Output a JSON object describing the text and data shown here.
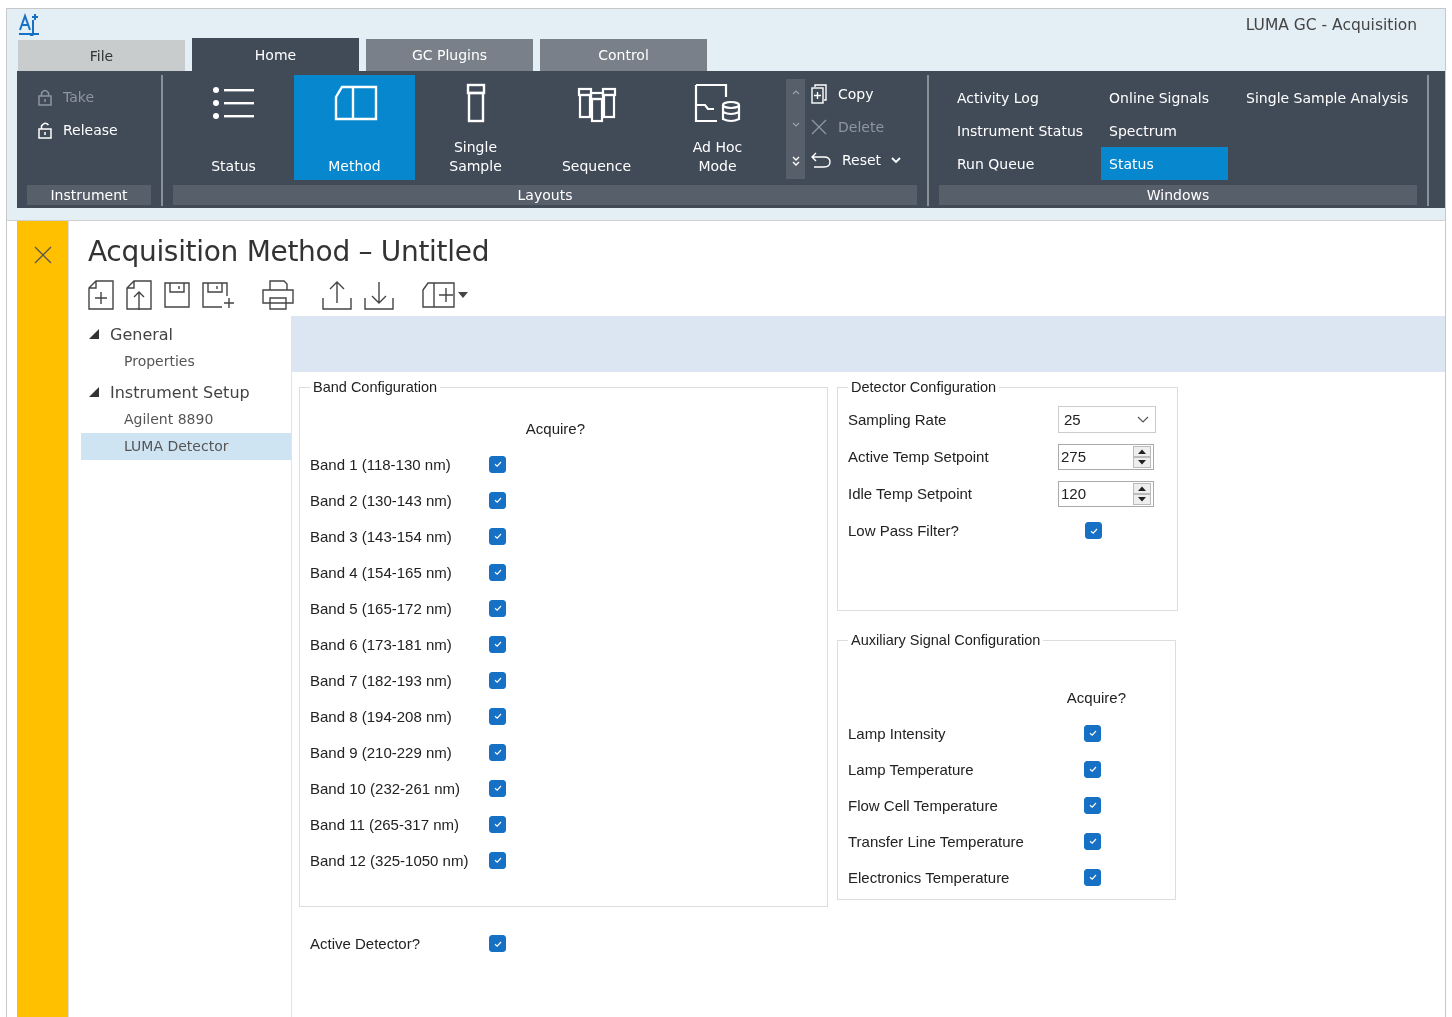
{
  "window": {
    "title": "LUMA GC - Acquisition"
  },
  "tabs": [
    {
      "label": "File",
      "selected": false,
      "kind": "file"
    },
    {
      "label": "Home",
      "selected": true,
      "kind": "tab"
    },
    {
      "label": "GC Plugins",
      "selected": false,
      "kind": "tab"
    },
    {
      "label": "Control",
      "selected": false,
      "kind": "tab"
    }
  ],
  "ribbon": {
    "instrument": {
      "label": "Instrument",
      "items": [
        {
          "label": "Take",
          "disabled": true,
          "kind": "lock"
        },
        {
          "label": "Release",
          "disabled": false,
          "kind": "unlock"
        }
      ]
    },
    "layouts": {
      "label": "Layouts",
      "buttons": [
        {
          "label": "Status",
          "kind": "list",
          "selected": false
        },
        {
          "label": "Method",
          "kind": "method",
          "selected": true
        },
        {
          "label": "Single Sample",
          "kind": "vial",
          "selected": false
        },
        {
          "label": "Sequence",
          "kind": "vials",
          "selected": false
        },
        {
          "label": "Ad Hoc Mode",
          "kind": "adhoc",
          "selected": false
        }
      ],
      "edit": [
        {
          "label": "Copy",
          "kind": "copy",
          "disabled": false
        },
        {
          "label": "Delete",
          "kind": "delete",
          "disabled": true
        },
        {
          "label": "Reset",
          "kind": "reset",
          "disabled": false
        }
      ]
    },
    "windows": {
      "label": "Windows",
      "columns": [
        [
          {
            "label": "Activity Log",
            "selected": false
          },
          {
            "label": "Instrument Status",
            "selected": false
          },
          {
            "label": "Run Queue",
            "selected": false
          }
        ],
        [
          {
            "label": "Online Signals",
            "selected": false
          },
          {
            "label": "Spectrum",
            "selected": false
          },
          {
            "label": "Status",
            "selected": true
          }
        ],
        [
          {
            "label": "Single Sample Analysis",
            "selected": false
          }
        ]
      ]
    }
  },
  "document": {
    "title": "Acquisition Method – Untitled"
  },
  "tree": [
    {
      "label": "General",
      "expanded": true,
      "children": [
        {
          "label": "Properties",
          "selected": false
        }
      ]
    },
    {
      "label": "Instrument Setup",
      "expanded": true,
      "children": [
        {
          "label": "Agilent 8890",
          "selected": false
        },
        {
          "label": "LUMA Detector",
          "selected": true
        }
      ]
    }
  ],
  "band_configuration": {
    "title": "Band Configuration",
    "column": "Acquire?",
    "bands": [
      {
        "label": "Band 1 (118-130 nm)",
        "checked": true
      },
      {
        "label": "Band 2 (130-143 nm)",
        "checked": true
      },
      {
        "label": "Band 3 (143-154 nm)",
        "checked": true
      },
      {
        "label": "Band 4 (154-165 nm)",
        "checked": true
      },
      {
        "label": "Band 5 (165-172 nm)",
        "checked": true
      },
      {
        "label": "Band 6 (173-181 nm)",
        "checked": true
      },
      {
        "label": "Band 7 (182-193 nm)",
        "checked": true
      },
      {
        "label": "Band 8 (194-208 nm)",
        "checked": true
      },
      {
        "label": "Band 9 (210-229 nm)",
        "checked": true
      },
      {
        "label": "Band 10 (232-261 nm)",
        "checked": true
      },
      {
        "label": "Band 11 (265-317 nm)",
        "checked": true
      },
      {
        "label": "Band 12 (325-1050 nm)",
        "checked": true
      }
    ]
  },
  "detector_configuration": {
    "title": "Detector Configuration",
    "fields": [
      {
        "label": "Sampling Rate",
        "kind": "dropdown",
        "value": "25"
      },
      {
        "label": "Active Temp Setpoint",
        "kind": "spinner",
        "value": "275"
      },
      {
        "label": "Idle Temp Setpoint",
        "kind": "spinner",
        "value": "120"
      },
      {
        "label": "Low Pass Filter?",
        "kind": "checkbox",
        "checked": true
      }
    ]
  },
  "auxiliary_signal_configuration": {
    "title": "Auxiliary Signal Configuration",
    "column": "Acquire?",
    "signals": [
      {
        "label": "Lamp Intensity",
        "checked": true
      },
      {
        "label": "Lamp Temperature",
        "checked": true
      },
      {
        "label": "Flow Cell Temperature",
        "checked": true
      },
      {
        "label": "Transfer Line Temperature",
        "checked": true
      },
      {
        "label": "Electronics Temperature",
        "checked": true
      }
    ]
  },
  "active_detector": {
    "label": "Active Detector?",
    "checked": true
  }
}
